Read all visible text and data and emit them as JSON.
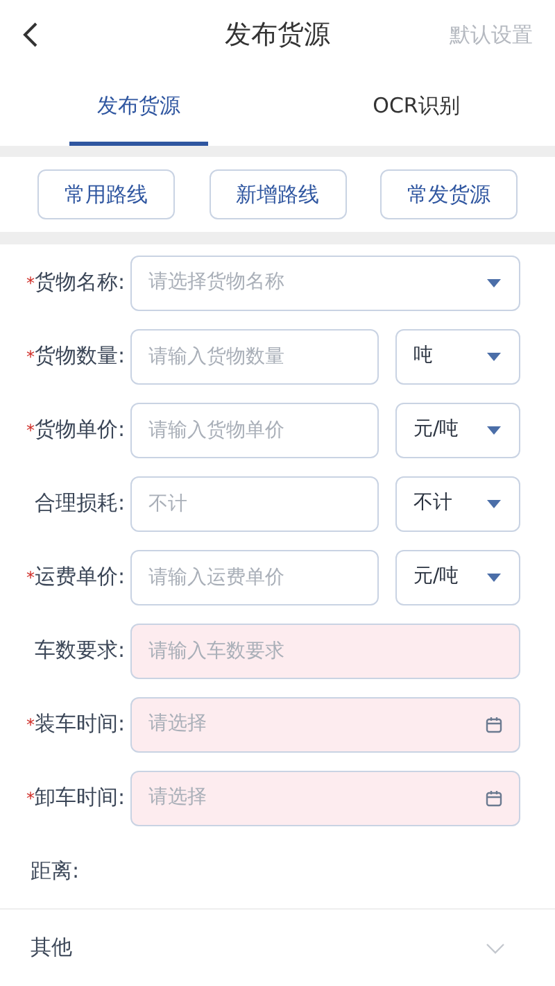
{
  "header": {
    "title": "发布货源",
    "action": "默认设置"
  },
  "tabs": [
    {
      "label": "发布货源",
      "selected": true
    },
    {
      "label": "OCR识别",
      "selected": false
    }
  ],
  "quick_buttons": [
    "常用路线",
    "新增路线",
    "常发货源"
  ],
  "form": [
    {
      "kind": "select",
      "label": "货物名称:",
      "mark": "*",
      "placeholder": "请选择货物名称",
      "highlighted": false
    },
    {
      "kind": "input_unit",
      "label": "货物数量:",
      "mark": "*",
      "placeholder": "请输入货物数量",
      "unit": "吨",
      "highlighted": false
    },
    {
      "kind": "input_unit",
      "label": "货物单价:",
      "mark": "*",
      "placeholder": "请输入货物单价",
      "unit": "元/吨",
      "highlighted": false
    },
    {
      "kind": "input_unit",
      "label": "合理损耗:",
      "placeholder": "不计",
      "unit": "不计",
      "highlighted": false
    },
    {
      "kind": "input_unit",
      "label": "运费单价:",
      "mark": "*",
      "placeholder": "请输入运费单价",
      "unit": "元/吨",
      "highlighted": false
    },
    {
      "kind": "input",
      "label": "车数要求:",
      "placeholder": "请输入车数要求",
      "highlighted": true
    },
    {
      "kind": "date",
      "label": "装车时间:",
      "mark": "*",
      "placeholder": "请选择",
      "highlighted": true
    },
    {
      "kind": "date",
      "label": "卸车时间:",
      "mark": "*",
      "placeholder": "请选择",
      "highlighted": true
    },
    {
      "kind": "text",
      "label": "距离:"
    }
  ],
  "other_section": {
    "label": "其他",
    "expanded": false
  }
}
